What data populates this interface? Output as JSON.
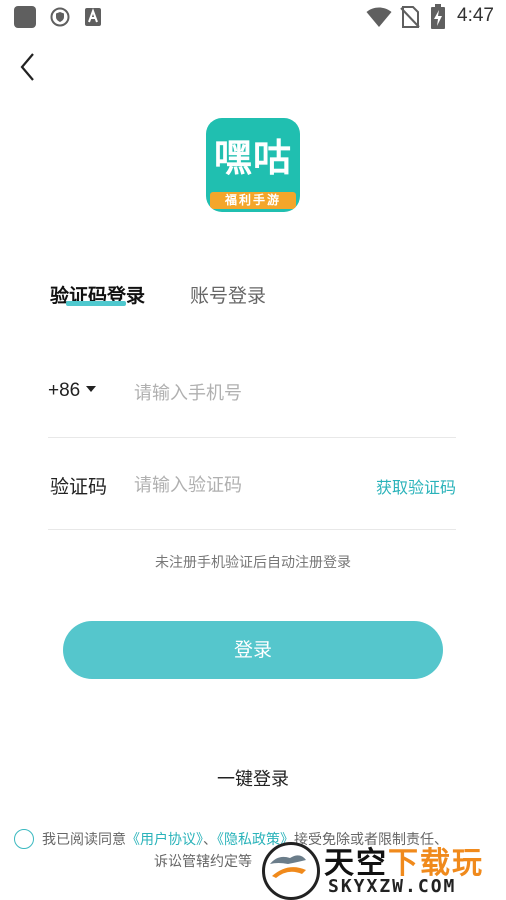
{
  "status_bar": {
    "time": "4:47",
    "left_icons": [
      "app-square-icon",
      "shield-icon",
      "text-a-icon"
    ],
    "right_icons": [
      "wifi-icon",
      "no-sim-icon",
      "battery-charging-icon"
    ]
  },
  "header": {
    "back_icon": "chevron-left-icon"
  },
  "logo": {
    "title": "嘿咕",
    "ribbon": "福利手游",
    "bg_color": "#20bfb0",
    "ribbon_color": "#f4a62a"
  },
  "tabs": [
    {
      "label": "验证码登录",
      "active": true
    },
    {
      "label": "账号登录",
      "active": false
    }
  ],
  "phone": {
    "country_code": "+86",
    "placeholder": "请输入手机号",
    "value": ""
  },
  "code": {
    "label": "验证码",
    "placeholder": "请输入验证码",
    "value": "",
    "get_code_label": "获取验证码"
  },
  "hint": "未注册手机验证后自动注册登录",
  "login_button": {
    "label": "登录",
    "color": "#55c6cc"
  },
  "one_key_login": "一键登录",
  "agreement": {
    "prefix": "我已阅读同意",
    "user_agreement": "《用户协议》",
    "separator": "、",
    "privacy_policy": "《隐私政策》",
    "suffix": "接受免除或者限制责任、",
    "line2": "诉讼管辖约定等"
  },
  "watermark": {
    "cn_part1": "天空",
    "cn_part2": "下载玩",
    "en": "SKYXZW.COM"
  },
  "accent_color": "#2ab3ba"
}
